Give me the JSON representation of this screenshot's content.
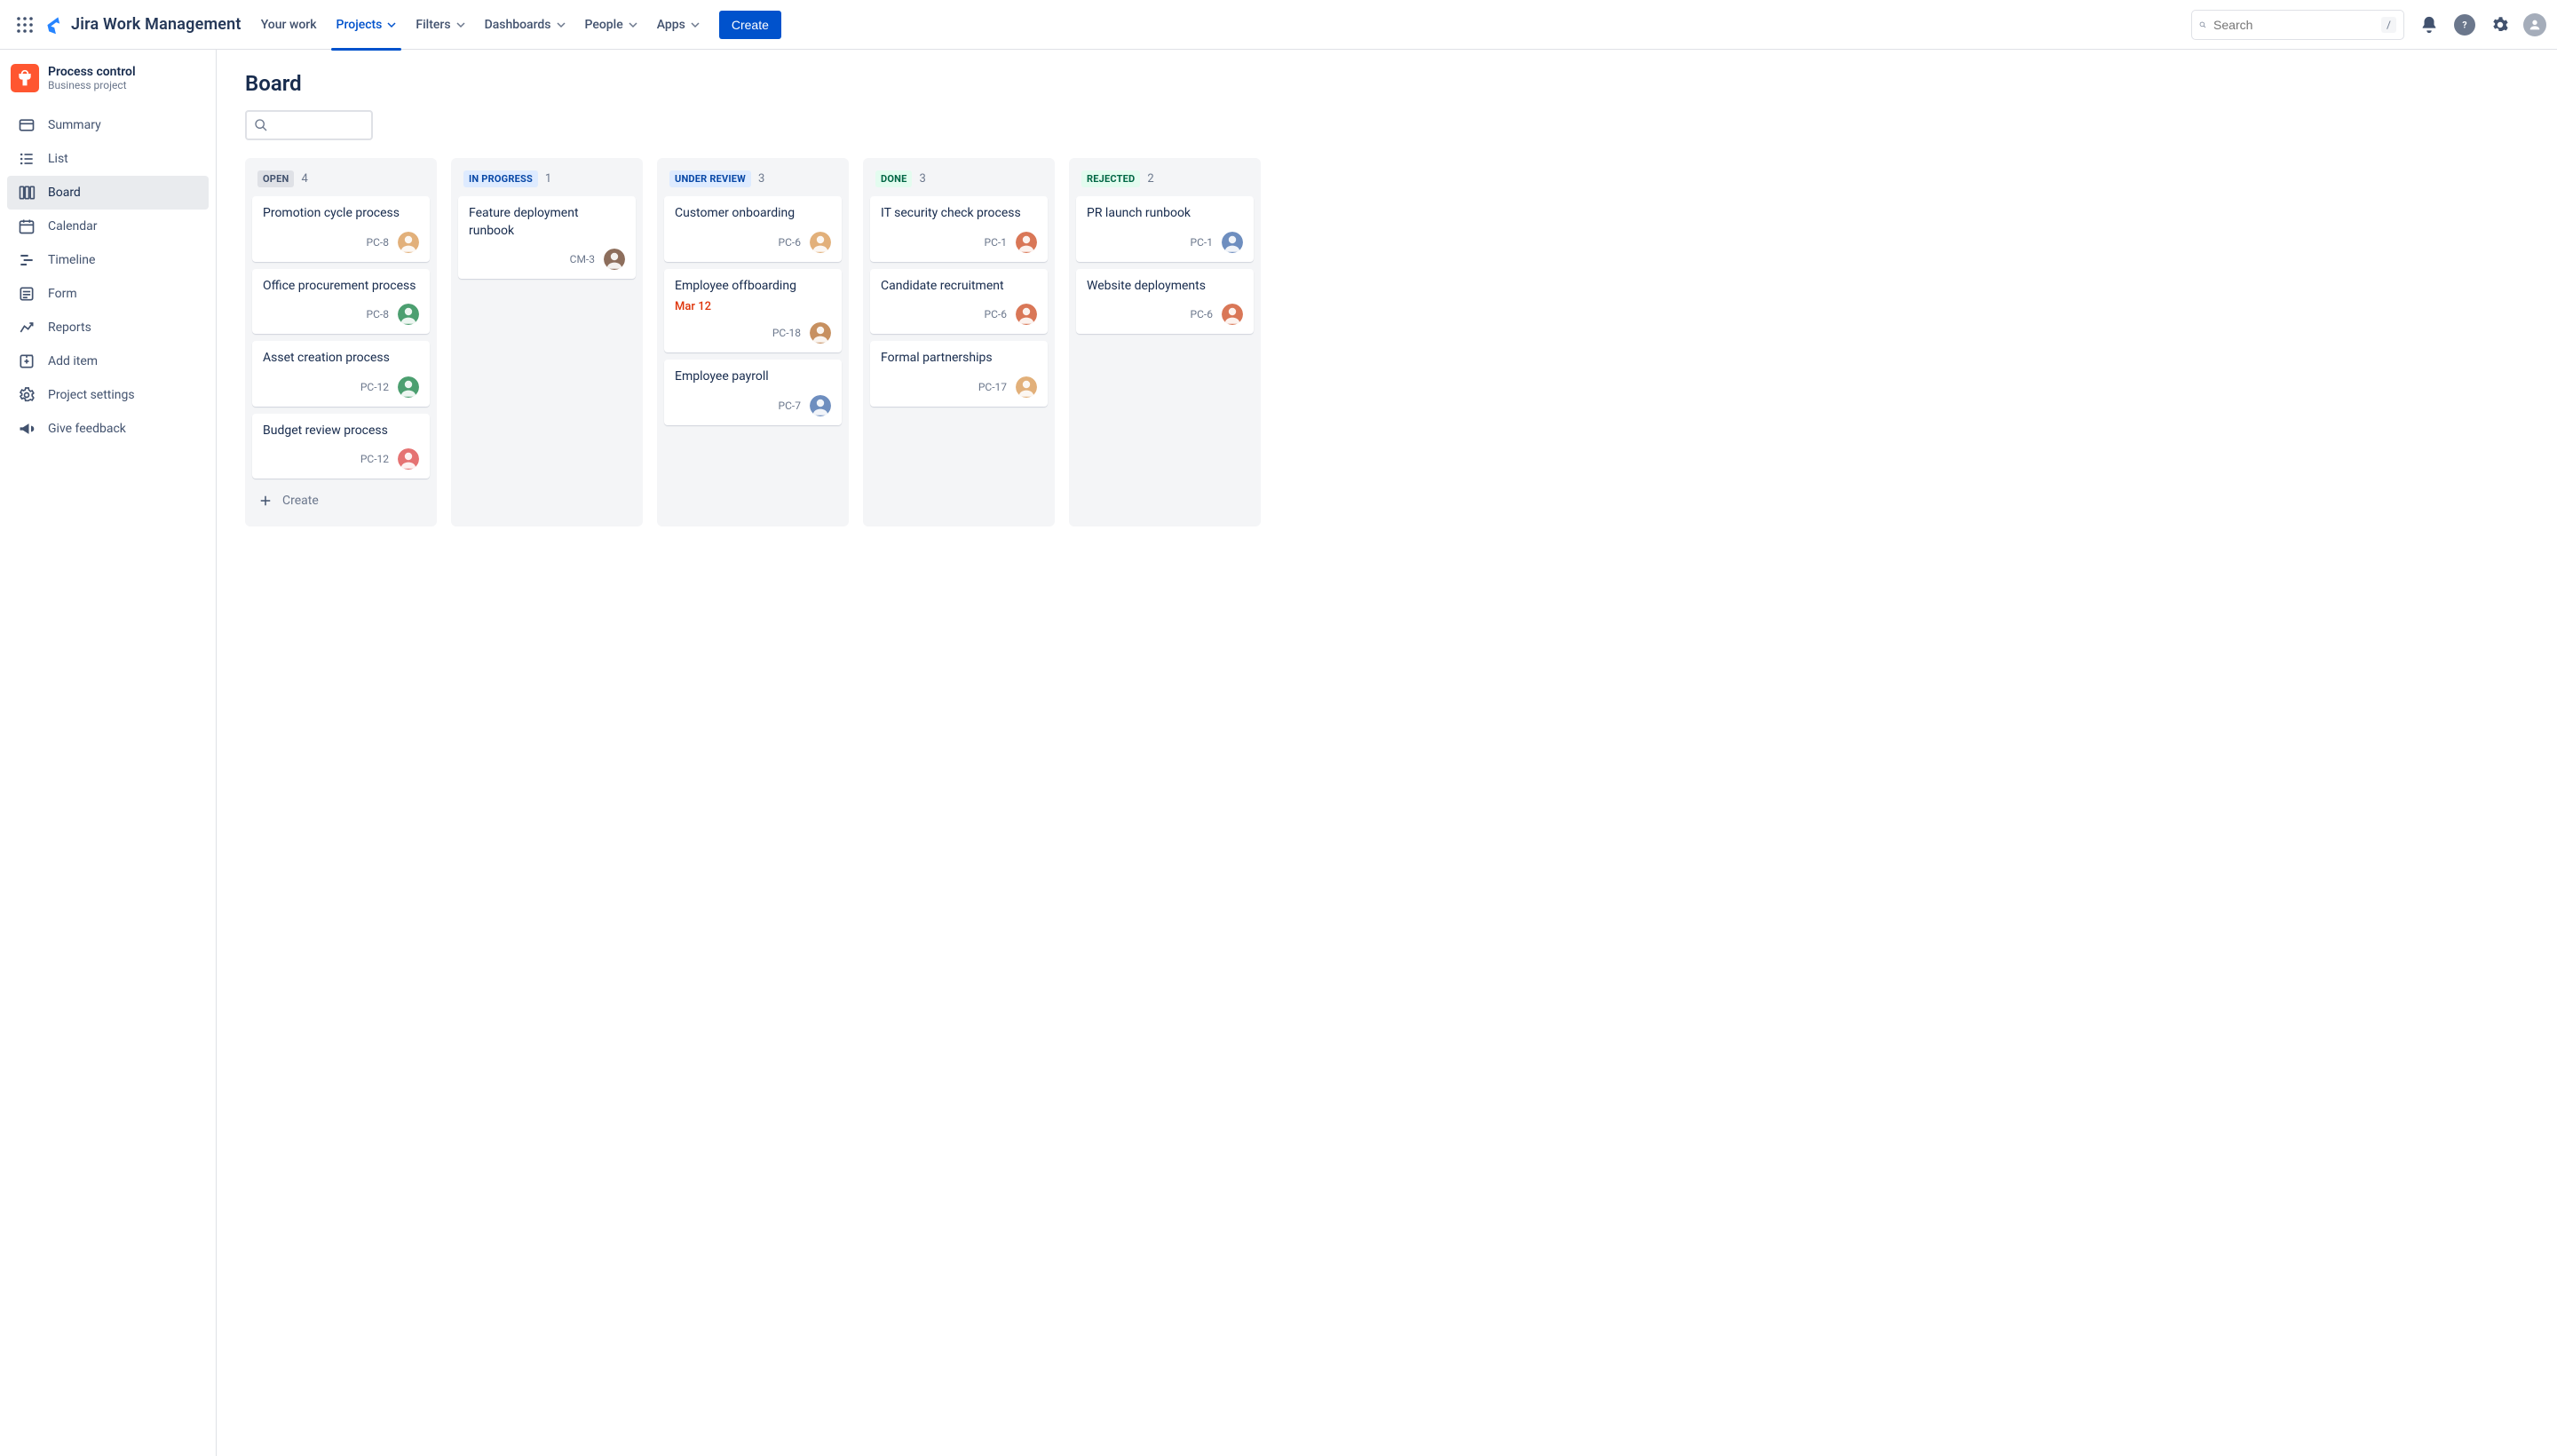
{
  "topnav": {
    "brand": "Jira Work Management",
    "your_work": "Your work",
    "projects": "Projects",
    "filters": "Filters",
    "dashboards": "Dashboards",
    "people": "People",
    "apps": "Apps",
    "create": "Create",
    "search_placeholder": "Search",
    "kbd_hint": "/"
  },
  "project": {
    "name": "Process control",
    "type": "Business project"
  },
  "sidebar": {
    "items": [
      {
        "label": "Summary"
      },
      {
        "label": "List"
      },
      {
        "label": "Board"
      },
      {
        "label": "Calendar"
      },
      {
        "label": "Timeline"
      },
      {
        "label": "Form"
      },
      {
        "label": "Reports"
      },
      {
        "label": "Add item"
      },
      {
        "label": "Project settings"
      },
      {
        "label": "Give feedback"
      }
    ]
  },
  "page": {
    "title": "Board",
    "create_label": "Create"
  },
  "avatars": {
    "a1": "#E2B07A",
    "a2": "#8D6E5C",
    "a3": "#4C9F70",
    "a4": "#E57373",
    "a5": "#B084CC",
    "a6": "#6E8EBF",
    "a7": "#C79060",
    "a8": "#D97757"
  },
  "columns": [
    {
      "name": "OPEN",
      "count": "4",
      "badge_bg": "#DFE1E6",
      "badge_fg": "#42526E",
      "cards": [
        {
          "title": "Promotion cycle process",
          "key": "PC-8",
          "avatar": "a1"
        },
        {
          "title": "Office procurement process",
          "key": "PC-8",
          "avatar": "a3"
        },
        {
          "title": "Asset creation process",
          "key": "PC-12",
          "avatar": "a3"
        },
        {
          "title": "Budget review process",
          "key": "PC-12",
          "avatar": "a4"
        }
      ],
      "show_create": true
    },
    {
      "name": "IN PROGRESS",
      "count": "1",
      "badge_bg": "#DEEBFF",
      "badge_fg": "#0747A6",
      "cards": [
        {
          "title": "Feature deployment runbook",
          "key": "CM-3",
          "avatar": "a2"
        }
      ]
    },
    {
      "name": "UNDER REVIEW",
      "count": "3",
      "badge_bg": "#DEEBFF",
      "badge_fg": "#0747A6",
      "cards": [
        {
          "title": "Customer onboarding",
          "key": "PC-6",
          "avatar": "a1"
        },
        {
          "title": "Employee offboarding",
          "key": "PC-18",
          "avatar": "a7",
          "date": "Mar 12"
        },
        {
          "title": "Employee payroll",
          "key": "PC-7",
          "avatar": "a6"
        }
      ]
    },
    {
      "name": "DONE",
      "count": "3",
      "badge_bg": "#E3FCEF",
      "badge_fg": "#006644",
      "cards": [
        {
          "title": "IT security check process",
          "key": "PC-1",
          "avatar": "a8"
        },
        {
          "title": "Candidate recruitment",
          "key": "PC-6",
          "avatar": "a8"
        },
        {
          "title": "Formal partnerships",
          "key": "PC-17",
          "avatar": "a1"
        }
      ]
    },
    {
      "name": "REJECTED",
      "count": "2",
      "badge_bg": "#E3FCEF",
      "badge_fg": "#006644",
      "cards": [
        {
          "title": "PR launch runbook",
          "key": "PC-1",
          "avatar": "a6"
        },
        {
          "title": "Website deployments",
          "key": "PC-6",
          "avatar": "a8"
        }
      ]
    }
  ]
}
